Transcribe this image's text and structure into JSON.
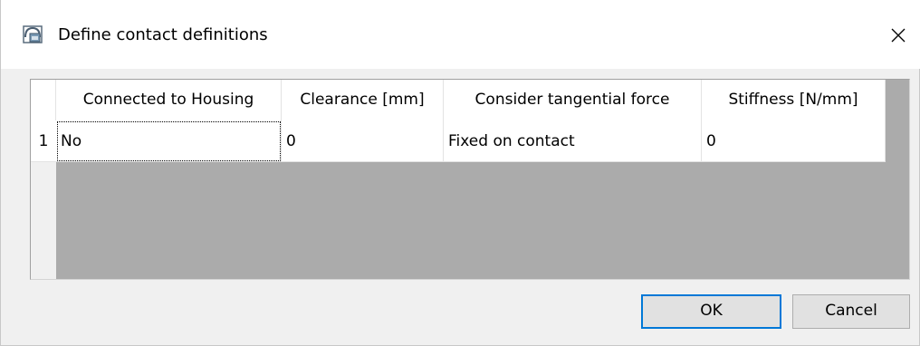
{
  "window": {
    "title": "Define contact definitions",
    "close_glyph": "✕"
  },
  "grid": {
    "columns": [
      "Connected to Housing",
      "Clearance [mm]",
      "Consider tangential force",
      "Stiffness [N/mm]"
    ],
    "rows": [
      {
        "index": "1",
        "cells": [
          "No",
          "0",
          "Fixed on contact",
          "0"
        ]
      }
    ]
  },
  "buttons": {
    "ok_label": "OK",
    "cancel_label": "Cancel"
  },
  "colors": {
    "accent": "#0078d7",
    "background": "#f0f0f0"
  },
  "icons": {
    "app": "app-icon",
    "close": "close-icon"
  }
}
